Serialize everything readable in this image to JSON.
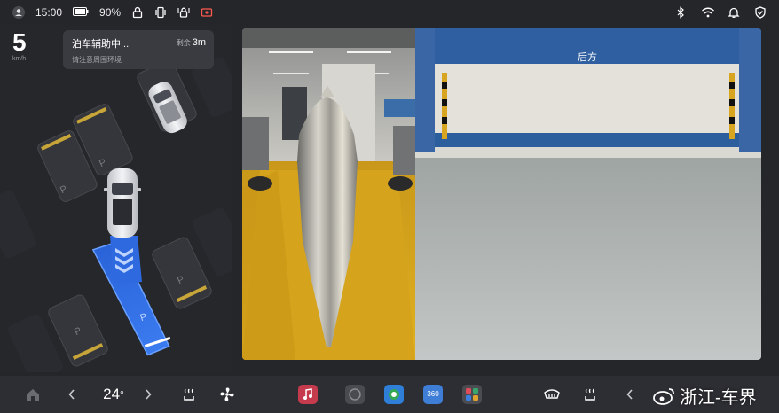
{
  "status_bar": {
    "time": "15:00",
    "battery": "90%",
    "icons": [
      "user-icon",
      "battery-icon",
      "lock-icon",
      "vibrate-icon",
      "rotate-lock-icon",
      "dashcam-icon",
      "bluetooth-icon",
      "wifi-icon",
      "bell-icon",
      "shield-icon"
    ]
  },
  "speed": {
    "value": "5",
    "unit": "km/h"
  },
  "parking_card": {
    "title": "泊车辅助中...",
    "remain_label": "剩余",
    "remain_value": "3m",
    "subtitle": "请注意周围环境"
  },
  "map": {
    "slot_label": "P"
  },
  "rear_camera": {
    "label": "后方"
  },
  "bottom_bar": {
    "temperature": "24",
    "temp_unit": "°",
    "apps": [
      "music-app-icon",
      "app-icon",
      "browser-app-icon",
      "360-app-icon",
      "apps-grid-icon"
    ],
    "app_360_label": "360"
  },
  "watermark": {
    "text": "浙江-车界"
  },
  "colors": {
    "background": "#25262a",
    "accent_blue": "#2f6fe0",
    "floor_yellow": "#d9a81a"
  }
}
